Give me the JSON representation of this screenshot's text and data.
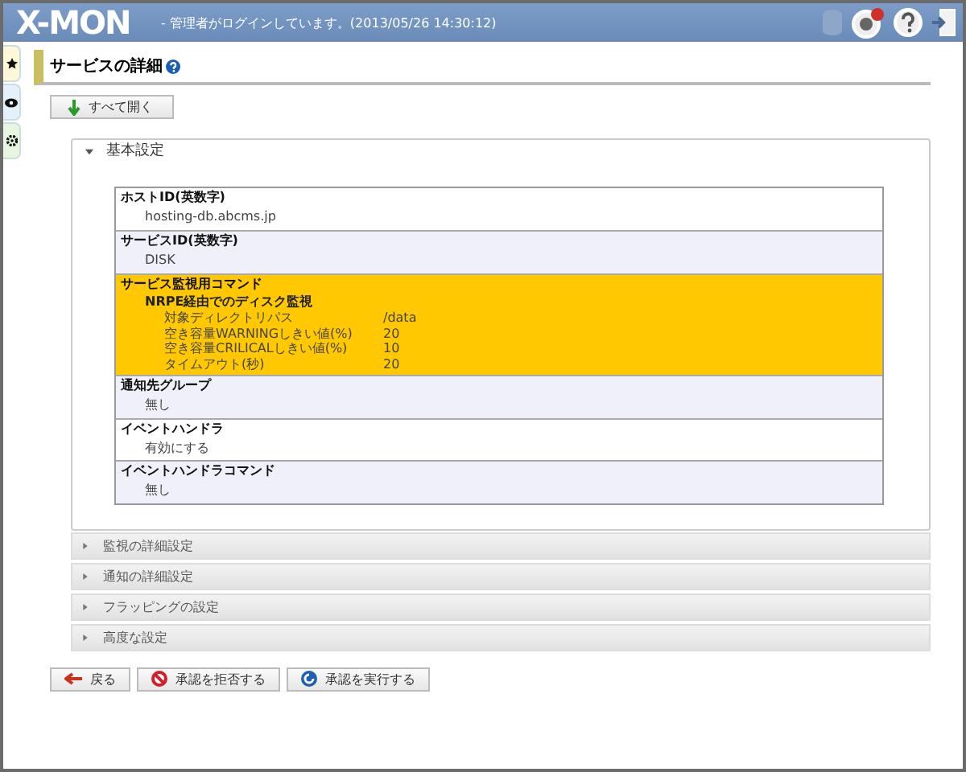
{
  "header": {
    "logo": "X-MON",
    "login_status": "- 管理者がログインしています。(2013/05/26 14:30:12)"
  },
  "side_tabs": [
    {
      "kind": "star",
      "selected": false
    },
    {
      "kind": "eye",
      "selected": false
    },
    {
      "kind": "gear",
      "selected": false
    }
  ],
  "page_title": "サービスの詳細",
  "expand_all_button": "すべて開く",
  "sections": [
    {
      "title": "基本設定",
      "expanded": true
    },
    {
      "title": "監視の詳細設定",
      "expanded": false
    },
    {
      "title": "通知の詳細設定",
      "expanded": false
    },
    {
      "title": "フラッピングの設定",
      "expanded": false
    },
    {
      "title": "高度な設定",
      "expanded": false
    }
  ],
  "fields": [
    {
      "kind": "plain",
      "label": "ホストID(英数字)",
      "value": "hosting-db.abcms.jp"
    },
    {
      "kind": "plain",
      "label": "サービスID(英数字)",
      "value": "DISK"
    },
    {
      "kind": "command",
      "label": "サービス監視用コマンド",
      "subtitle": "NRPE経由でのディスク監視",
      "params": [
        {
          "name": "対象ディレクトリパス",
          "value": "/data"
        },
        {
          "name": "空き容量WARNINGしきい値(%)",
          "value": "20"
        },
        {
          "name": "空き容量CRILICALしきい値(%)",
          "value": "10"
        },
        {
          "name": "タイムアウト(秒)",
          "value": "20"
        }
      ]
    },
    {
      "kind": "plain",
      "label": "通知先グループ",
      "value": "無し"
    },
    {
      "kind": "plain",
      "label": "イベントハンドラ",
      "value": "有効にする"
    },
    {
      "kind": "plain",
      "label": "イベントハンドラコマンド",
      "value": "無し"
    }
  ],
  "buttons": [
    {
      "kind": "back",
      "label": "戻る"
    },
    {
      "kind": "reject",
      "label": "承認を拒否する"
    },
    {
      "kind": "approve",
      "label": "承認を実行する"
    }
  ]
}
